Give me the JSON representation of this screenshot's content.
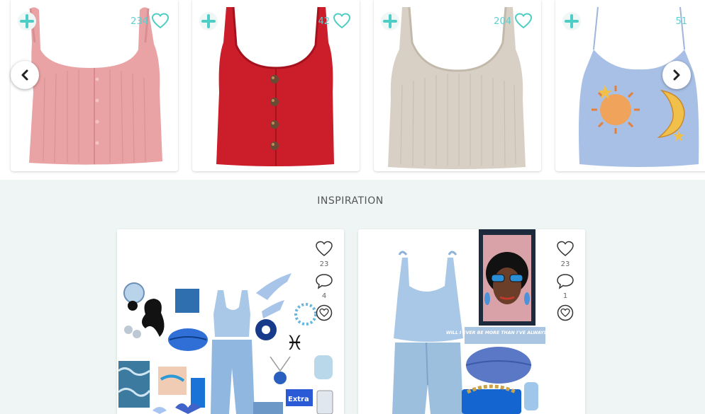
{
  "products": [
    {
      "name": "pink ruffle ribbed tank",
      "like_count": "234",
      "color": "#e9a3a5"
    },
    {
      "name": "red button ribbed tank",
      "like_count": "42",
      "color": "#cc1d2a"
    },
    {
      "name": "beige ribbed tank",
      "like_count": "204",
      "color": "#d8d0c4"
    },
    {
      "name": "blue sun moon cami",
      "like_count": "51",
      "color": "#a9c0e6"
    }
  ],
  "icons": {
    "add": "plus-icon",
    "like": "heart-icon",
    "comment": "comment-icon",
    "save": "heart-save-icon",
    "prev": "chevron-left-icon",
    "next": "chevron-right-icon"
  },
  "inspiration": {
    "title": "INSPIRATION",
    "sets": [
      {
        "likes": "23",
        "comments": "4"
      },
      {
        "likes": "23",
        "comments": "1",
        "poster_text": "WILL I EVER BE MORE THAN I'VE ALWAYS BEEN?"
      }
    ]
  },
  "colors": {
    "accent": "#4ecdc4",
    "background": "#eef5f4"
  }
}
